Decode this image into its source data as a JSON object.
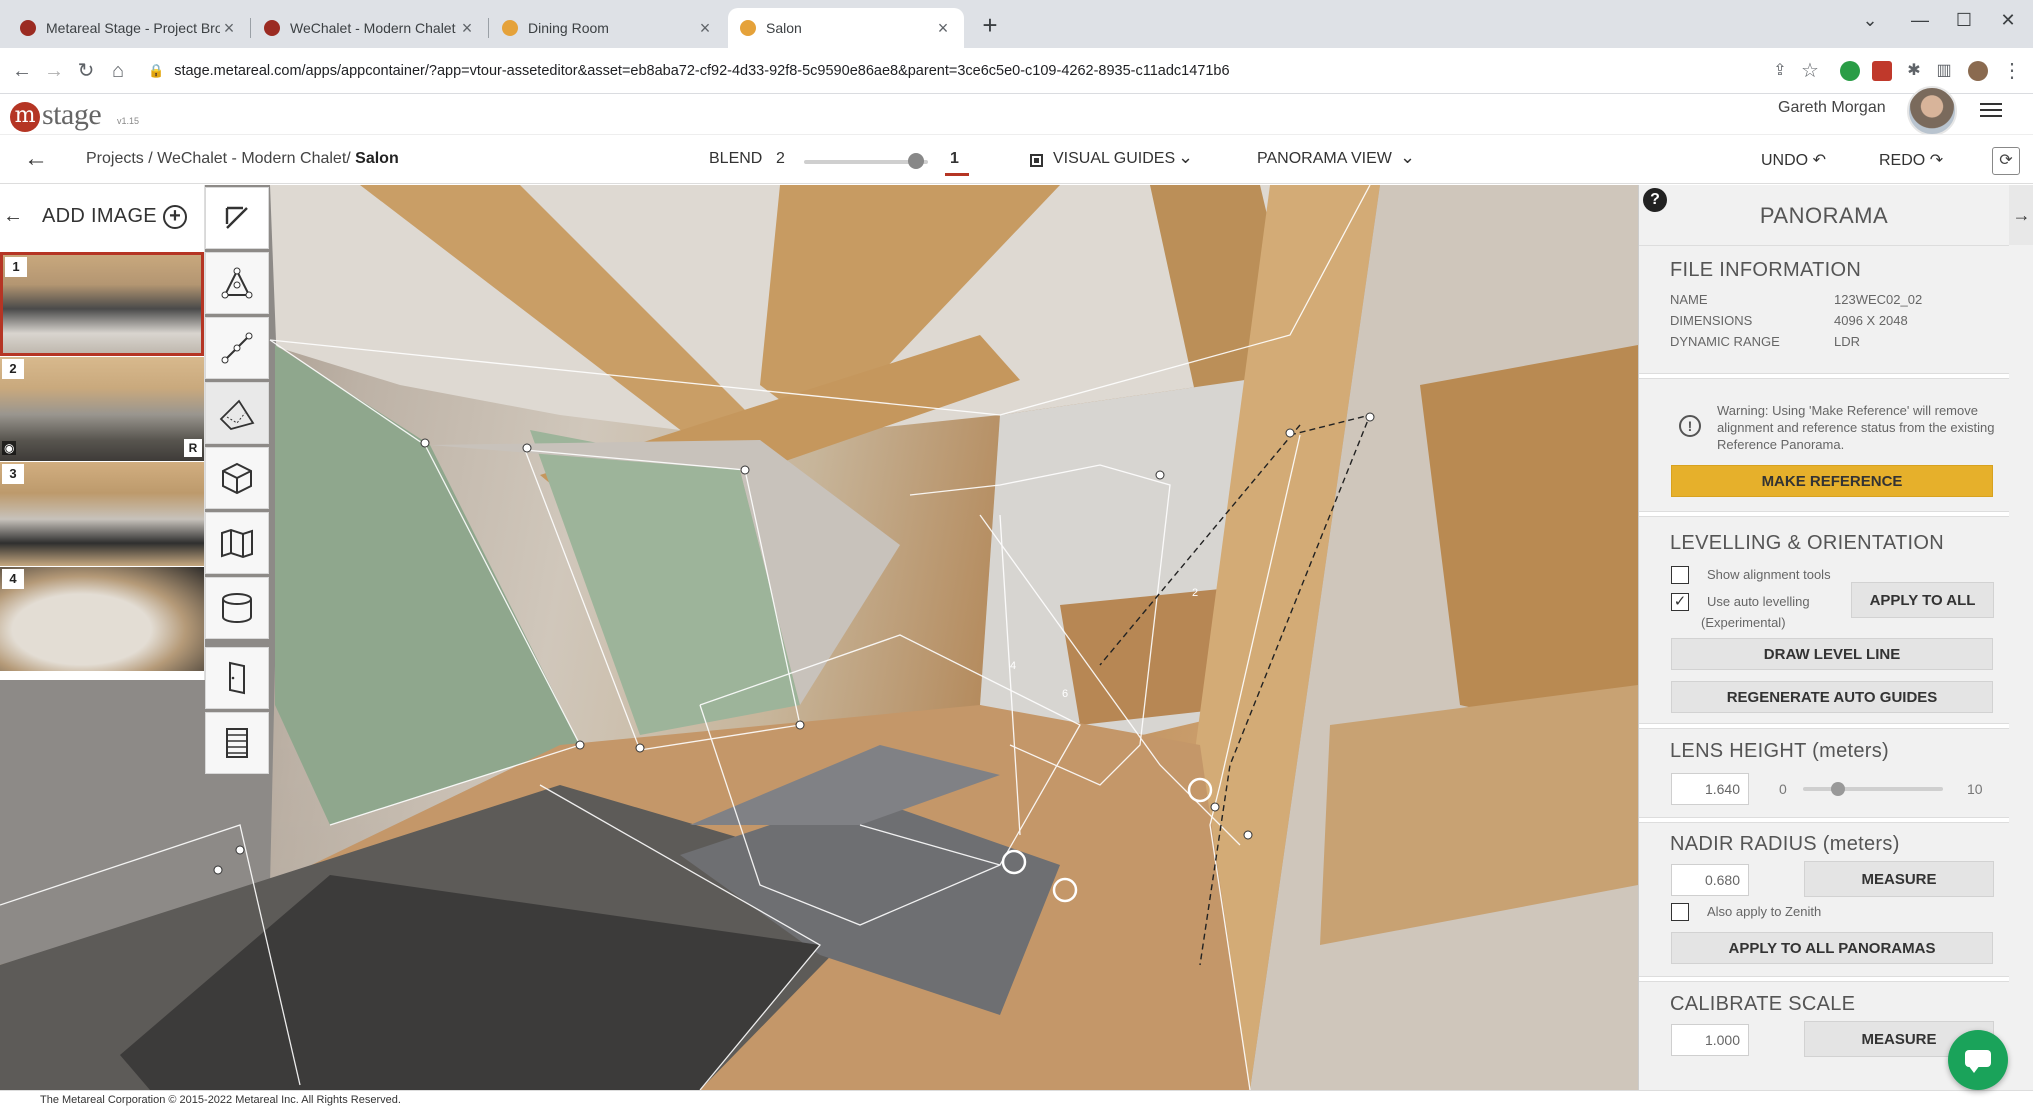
{
  "browser": {
    "tabs": [
      {
        "title": "Metareal Stage - Project Browser",
        "favicon": "metareal-red"
      },
      {
        "title": "WeChalet - Modern Chalet",
        "favicon": "metareal-red"
      },
      {
        "title": "Dining Room",
        "favicon": "metareal-orange"
      },
      {
        "title": "Salon",
        "favicon": "metareal-orange",
        "active": true
      }
    ],
    "url": "stage.metareal.com/apps/appcontainer/?app=vtour-asseteditor&asset=eb8aba72-cf92-4d33-92f8-5c9590e86ae8&parent=3ce6c5e0-c109-4262-8935-c11adc1471b6"
  },
  "app": {
    "logo_text": "stage",
    "version": "v1.15",
    "user_name": "Gareth Morgan"
  },
  "toolbar": {
    "breadcrumb_path": "Projects / WeChalet - Modern Chalet/ ",
    "breadcrumb_current": "Salon",
    "blend_label": "BLEND",
    "blend_value": "2",
    "blend_secondary": "1",
    "blend_level": 0.9,
    "visual_guides_label": "VISUAL GUIDES",
    "panorama_view_label": "PANORAMA VIEW",
    "undo_label": "UNDO",
    "redo_label": "REDO"
  },
  "sidebar": {
    "add_image_label": "ADD IMAGE",
    "thumbnails": [
      {
        "number": "1",
        "selected": true
      },
      {
        "number": "2",
        "badge": "R",
        "visible_icon": "eye-icon"
      },
      {
        "number": "3"
      },
      {
        "number": "4"
      }
    ]
  },
  "tools": [
    "select-arrow-icon",
    "polygon-tool-icon",
    "line-tool-icon",
    "floor-plane-icon",
    "cube-icon",
    "map-icon",
    "cylinder-icon",
    "door-icon",
    "stairs-icon"
  ],
  "panel": {
    "title": "PANORAMA",
    "file_information": {
      "heading": "FILE INFORMATION",
      "rows": [
        {
          "label": "NAME",
          "value": "123WEC02_02"
        },
        {
          "label": "DIMENSIONS",
          "value": "4096 X 2048"
        },
        {
          "label": "DYNAMIC RANGE",
          "value": "LDR"
        }
      ]
    },
    "warning_text": "Warning: Using 'Make Reference' will remove alignment and reference status from the existing Reference Panorama.",
    "make_reference_label": "MAKE REFERENCE",
    "levelling": {
      "heading": "LEVELLING & ORIENTATION",
      "show_alignment_label": "Show alignment tools",
      "show_alignment_checked": false,
      "auto_levelling_label": "Use auto levelling",
      "auto_levelling_sub": "(Experimental)",
      "auto_levelling_checked": true,
      "apply_to_all_label": "APPLY TO ALL",
      "draw_level_line_label": "DRAW LEVEL LINE",
      "regenerate_label": "REGENERATE AUTO GUIDES"
    },
    "lens_height": {
      "heading": "LENS HEIGHT (meters)",
      "value": "1.640",
      "min": "0",
      "max": "10",
      "slider_level": 0.164
    },
    "nadir_radius": {
      "heading": "NADIR RADIUS (meters)",
      "value": "0.680",
      "measure_label": "MEASURE",
      "zenith_label": "Also apply to Zenith",
      "zenith_checked": false,
      "apply_all_label": "APPLY TO ALL PANORAMAS"
    },
    "calibrate_scale": {
      "heading": "CALIBRATE SCALE",
      "value": "1.000",
      "measure_label": "MEASURE"
    }
  },
  "viewport": {
    "hotspots": [
      "2",
      "4",
      "6"
    ]
  },
  "footer": {
    "copyright": "The Metareal Corporation © 2015-2022 Metareal Inc. All Rights Reserved."
  },
  "colors": {
    "brand_red": "#b53524",
    "accent_yellow": "#e6b02b",
    "chat_green": "#1aa35a"
  }
}
